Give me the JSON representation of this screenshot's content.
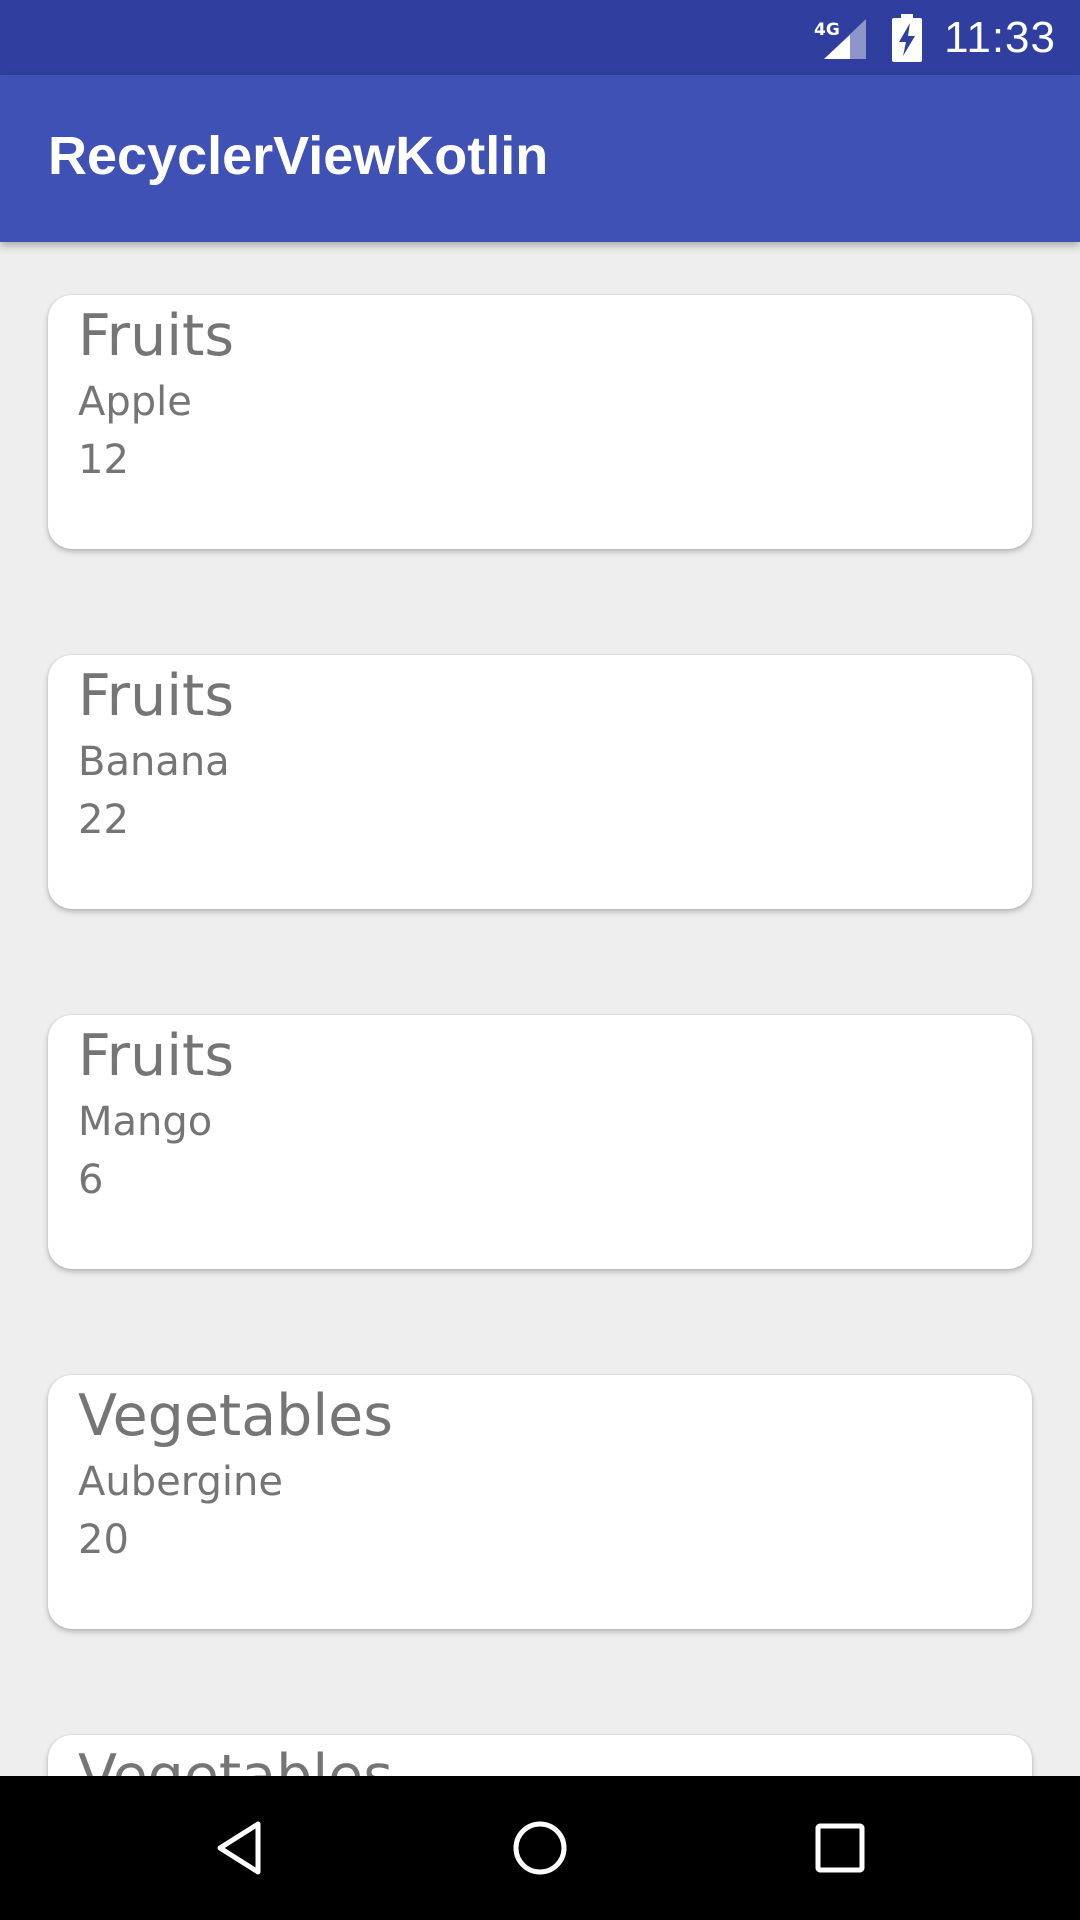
{
  "status_bar": {
    "network_label": "4G",
    "time": "11:33",
    "background_color": "#303f9f"
  },
  "app_bar": {
    "title": "RecyclerViewKotlin",
    "background_color": "#3f51b5"
  },
  "list": {
    "items": [
      {
        "category": "Fruits",
        "name": "Apple",
        "count": "12"
      },
      {
        "category": "Fruits",
        "name": "Banana",
        "count": "22"
      },
      {
        "category": "Fruits",
        "name": "Mango",
        "count": "6"
      },
      {
        "category": "Vegetables",
        "name": "Aubergine",
        "count": "20"
      },
      {
        "category": "Vegetables",
        "name": "",
        "count": ""
      }
    ]
  },
  "nav_bar": {
    "icons": [
      "back-icon",
      "home-icon",
      "recents-icon"
    ]
  }
}
